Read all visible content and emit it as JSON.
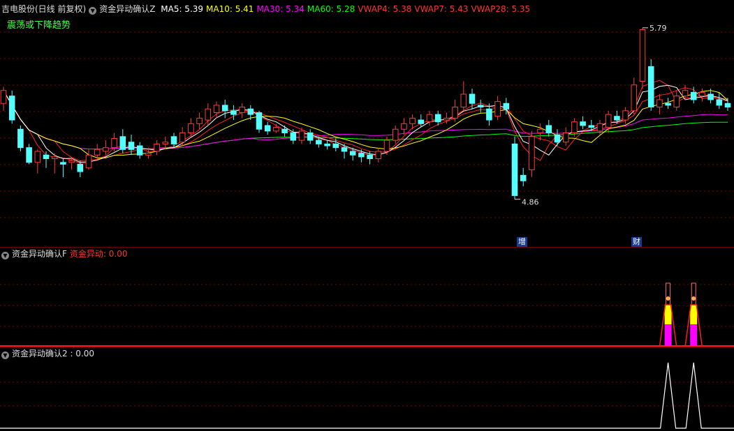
{
  "header": {
    "stock": "吉电股份(日线 前复权)",
    "indicator": "资金异动确认Z",
    "ma": [
      {
        "label": "MA5: 5.39",
        "color": "#ffffff"
      },
      {
        "label": "MA10: 5.41",
        "color": "#ffff00"
      },
      {
        "label": "MA30: 5.34",
        "color": "#ff00ff"
      },
      {
        "label": "MA60: 5.28",
        "color": "#00ff00"
      },
      {
        "label": "VWAP4: 5.38",
        "color": "#ff3333"
      },
      {
        "label": "VWAP7: 5.43",
        "color": "#ff3333"
      },
      {
        "label": "VWAP28: 5.35",
        "color": "#ff3333"
      }
    ],
    "trend_label": "震荡或下降趋势"
  },
  "panel2": {
    "title": "资金异动确认F",
    "value_label": "资金异动: 0.00"
  },
  "panel3": {
    "title": "资金异动确认2 : 0.00"
  },
  "tags": {
    "zeng": "增",
    "cai": "财"
  },
  "colors": {
    "up": "#ff3a3a",
    "down": "#54ffff",
    "grid": "#7a0000",
    "border": "#b00000",
    "ma5": "#ffffff",
    "ma10": "#ffff00",
    "ma30": "#ff00ff",
    "ma60": "#00ff00",
    "vwap": "#ff2020"
  },
  "chart_data": {
    "type": "candlestick",
    "price_range": [
      4.7,
      5.85
    ],
    "max_label": "5.79",
    "min_label": "4.86",
    "max_index": 75,
    "min_index": 60,
    "candles": [
      {
        "o": 5.38,
        "c": 5.45,
        "h": 5.47,
        "l": 5.34
      },
      {
        "o": 5.42,
        "c": 5.29,
        "h": 5.45,
        "l": 5.27
      },
      {
        "o": 5.24,
        "c": 5.14,
        "h": 5.26,
        "l": 5.12
      },
      {
        "o": 5.14,
        "c": 5.06,
        "h": 5.16,
        "l": 5.05
      },
      {
        "o": 5.06,
        "c": 5.12,
        "h": 5.13,
        "l": 5.0
      },
      {
        "o": 5.1,
        "c": 5.08,
        "h": 5.12,
        "l": 5.03
      },
      {
        "o": 5.08,
        "c": 5.09,
        "h": 5.11,
        "l": 5.0
      },
      {
        "o": 5.06,
        "c": 5.05,
        "h": 5.08,
        "l": 4.98
      },
      {
        "o": 5.06,
        "c": 5.07,
        "h": 5.09,
        "l": 5.02
      },
      {
        "o": 5.05,
        "c": 5.01,
        "h": 5.07,
        "l": 4.98
      },
      {
        "o": 5.03,
        "c": 5.1,
        "h": 5.13,
        "l": 5.02
      },
      {
        "o": 5.1,
        "c": 5.13,
        "h": 5.16,
        "l": 5.08
      },
      {
        "o": 5.12,
        "c": 5.14,
        "h": 5.18,
        "l": 5.1
      },
      {
        "o": 5.14,
        "c": 5.19,
        "h": 5.22,
        "l": 5.12
      },
      {
        "o": 5.2,
        "c": 5.13,
        "h": 5.24,
        "l": 5.11
      },
      {
        "o": 5.17,
        "c": 5.13,
        "h": 5.21,
        "l": 5.1
      },
      {
        "o": 5.15,
        "c": 5.1,
        "h": 5.17,
        "l": 5.08
      },
      {
        "o": 5.1,
        "c": 5.11,
        "h": 5.14,
        "l": 5.08
      },
      {
        "o": 5.12,
        "c": 5.16,
        "h": 5.18,
        "l": 5.1
      },
      {
        "o": 5.16,
        "c": 5.17,
        "h": 5.2,
        "l": 5.13
      },
      {
        "o": 5.2,
        "c": 5.16,
        "h": 5.22,
        "l": 5.14
      },
      {
        "o": 5.17,
        "c": 5.22,
        "h": 5.25,
        "l": 5.15
      },
      {
        "o": 5.22,
        "c": 5.27,
        "h": 5.3,
        "l": 5.2
      },
      {
        "o": 5.27,
        "c": 5.3,
        "h": 5.33,
        "l": 5.24
      },
      {
        "o": 5.29,
        "c": 5.35,
        "h": 5.38,
        "l": 5.26
      },
      {
        "o": 5.33,
        "c": 5.37,
        "h": 5.39,
        "l": 5.3
      },
      {
        "o": 5.37,
        "c": 5.34,
        "h": 5.4,
        "l": 5.3
      },
      {
        "o": 5.34,
        "c": 5.32,
        "h": 5.37,
        "l": 5.29
      },
      {
        "o": 5.33,
        "c": 5.36,
        "h": 5.38,
        "l": 5.3
      },
      {
        "o": 5.35,
        "c": 5.32,
        "h": 5.37,
        "l": 5.29
      },
      {
        "o": 5.33,
        "c": 5.24,
        "h": 5.34,
        "l": 5.22
      },
      {
        "o": 5.26,
        "c": 5.23,
        "h": 5.28,
        "l": 5.21
      },
      {
        "o": 5.23,
        "c": 5.25,
        "h": 5.27,
        "l": 5.22
      },
      {
        "o": 5.24,
        "c": 5.22,
        "h": 5.26,
        "l": 5.2
      },
      {
        "o": 5.22,
        "c": 5.18,
        "h": 5.24,
        "l": 5.16
      },
      {
        "o": 5.18,
        "c": 5.23,
        "h": 5.25,
        "l": 5.16
      },
      {
        "o": 5.22,
        "c": 5.18,
        "h": 5.24,
        "l": 5.16
      },
      {
        "o": 5.18,
        "c": 5.16,
        "h": 5.2,
        "l": 5.14
      },
      {
        "o": 5.16,
        "c": 5.15,
        "h": 5.18,
        "l": 5.13
      },
      {
        "o": 5.16,
        "c": 5.14,
        "h": 5.19,
        "l": 5.12
      },
      {
        "o": 5.14,
        "c": 5.12,
        "h": 5.16,
        "l": 5.08
      },
      {
        "o": 5.12,
        "c": 5.1,
        "h": 5.14,
        "l": 5.07
      },
      {
        "o": 5.11,
        "c": 5.09,
        "h": 5.13,
        "l": 5.06
      },
      {
        "o": 5.1,
        "c": 5.08,
        "h": 5.12,
        "l": 5.05
      },
      {
        "o": 5.08,
        "c": 5.12,
        "h": 5.14,
        "l": 5.06
      },
      {
        "o": 5.12,
        "c": 5.18,
        "h": 5.2,
        "l": 5.1
      },
      {
        "o": 5.18,
        "c": 5.24,
        "h": 5.26,
        "l": 5.16
      },
      {
        "o": 5.24,
        "c": 5.27,
        "h": 5.3,
        "l": 5.21
      },
      {
        "o": 5.27,
        "c": 5.3,
        "h": 5.32,
        "l": 5.24
      },
      {
        "o": 5.29,
        "c": 5.27,
        "h": 5.32,
        "l": 5.25
      },
      {
        "o": 5.28,
        "c": 5.32,
        "h": 5.34,
        "l": 5.26
      },
      {
        "o": 5.32,
        "c": 5.28,
        "h": 5.34,
        "l": 5.26
      },
      {
        "o": 5.29,
        "c": 5.3,
        "h": 5.33,
        "l": 5.27
      },
      {
        "o": 5.3,
        "c": 5.36,
        "h": 5.4,
        "l": 5.28
      },
      {
        "o": 5.36,
        "c": 5.43,
        "h": 5.5,
        "l": 5.34
      },
      {
        "o": 5.43,
        "c": 5.38,
        "h": 5.46,
        "l": 5.35
      },
      {
        "o": 5.37,
        "c": 5.36,
        "h": 5.4,
        "l": 5.33
      },
      {
        "o": 5.35,
        "c": 5.29,
        "h": 5.38,
        "l": 5.26
      },
      {
        "o": 5.31,
        "c": 5.39,
        "h": 5.42,
        "l": 5.29
      },
      {
        "o": 5.38,
        "c": 5.35,
        "h": 5.41,
        "l": 5.32
      },
      {
        "o": 5.16,
        "c": 4.88,
        "h": 5.2,
        "l": 4.86
      },
      {
        "o": 4.99,
        "c": 4.96,
        "h": 5.03,
        "l": 4.93
      },
      {
        "o": 5.02,
        "c": 5.2,
        "h": 5.23,
        "l": 4.98
      },
      {
        "o": 5.22,
        "c": 5.24,
        "h": 5.27,
        "l": 5.18
      },
      {
        "o": 5.26,
        "c": 5.22,
        "h": 5.29,
        "l": 5.2
      },
      {
        "o": 5.21,
        "c": 5.17,
        "h": 5.24,
        "l": 5.15
      },
      {
        "o": 5.17,
        "c": 5.22,
        "h": 5.25,
        "l": 5.15
      },
      {
        "o": 5.22,
        "c": 5.28,
        "h": 5.3,
        "l": 5.2
      },
      {
        "o": 5.28,
        "c": 5.26,
        "h": 5.31,
        "l": 5.24
      },
      {
        "o": 5.26,
        "c": 5.25,
        "h": 5.29,
        "l": 5.23
      },
      {
        "o": 5.23,
        "c": 5.27,
        "h": 5.29,
        "l": 5.21
      },
      {
        "o": 5.25,
        "c": 5.32,
        "h": 5.34,
        "l": 5.22
      },
      {
        "o": 5.31,
        "c": 5.29,
        "h": 5.34,
        "l": 5.27
      },
      {
        "o": 5.29,
        "c": 5.34,
        "h": 5.36,
        "l": 5.27
      },
      {
        "o": 5.34,
        "c": 5.48,
        "h": 5.52,
        "l": 5.32
      },
      {
        "o": 5.5,
        "c": 5.78,
        "h": 5.79,
        "l": 5.46
      },
      {
        "o": 5.58,
        "c": 5.36,
        "h": 5.62,
        "l": 5.34
      },
      {
        "o": 5.36,
        "c": 5.4,
        "h": 5.43,
        "l": 5.32
      },
      {
        "o": 5.38,
        "c": 5.37,
        "h": 5.41,
        "l": 5.35
      },
      {
        "o": 5.36,
        "c": 5.42,
        "h": 5.45,
        "l": 5.34
      },
      {
        "o": 5.42,
        "c": 5.45,
        "h": 5.48,
        "l": 5.4
      },
      {
        "o": 5.44,
        "c": 5.4,
        "h": 5.47,
        "l": 5.38
      },
      {
        "o": 5.42,
        "c": 5.44,
        "h": 5.46,
        "l": 5.39
      },
      {
        "o": 5.43,
        "c": 5.4,
        "h": 5.46,
        "l": 5.38
      },
      {
        "o": 5.4,
        "c": 5.37,
        "h": 5.44,
        "l": 5.35
      },
      {
        "o": 5.38,
        "c": 5.36,
        "h": 5.41,
        "l": 5.34
      }
    ],
    "signal_f": {
      "spikes": [
        78,
        81
      ]
    },
    "signal_2": {
      "spikes": [
        78,
        81
      ]
    }
  }
}
